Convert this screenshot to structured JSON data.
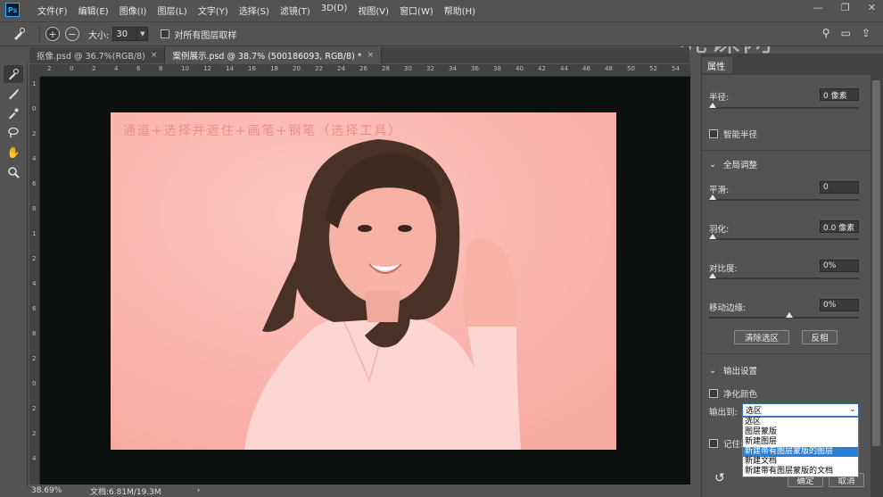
{
  "menubar": {
    "logo": "Ps",
    "items": [
      "文件(F)",
      "编辑(E)",
      "图像(I)",
      "图层(L)",
      "文字(Y)",
      "选择(S)",
      "滤镜(T)",
      "3D(D)",
      "视图(V)",
      "窗口(W)",
      "帮助(H)"
    ]
  },
  "watermark": "虎课网",
  "options": {
    "size_label": "大小:",
    "size_value": "30",
    "sample_all_layers": "对所有图层取样"
  },
  "tabs": [
    {
      "label": "抠像.psd @ 36.7%(RGB/8)",
      "close": "×"
    },
    {
      "label": "案例展示.psd @ 38.7% (500186093, RGB/8) *",
      "close": "×"
    }
  ],
  "ruler": {
    "h_ticks": [
      "2",
      "0",
      "2",
      "4",
      "6",
      "8",
      "10",
      "12",
      "14",
      "16",
      "18",
      "20",
      "22",
      "24",
      "26",
      "28",
      "30",
      "32",
      "34",
      "36",
      "38",
      "40",
      "42",
      "44",
      "46",
      "48",
      "50",
      "52",
      "54"
    ],
    "v_ticks": [
      "1",
      "0",
      "2",
      "4",
      "6",
      "8",
      "1",
      "2",
      "4",
      "6",
      "8",
      "2",
      "0",
      "2",
      "2",
      "4"
    ]
  },
  "canvas": {
    "title_text": "通道+选择并遮住+画笔+钢笔（选择工具）",
    "photo_bg": "#fbb5ad"
  },
  "status": {
    "zoom": "38.69%",
    "doc": "文档:6.81M/19.3M",
    "arrow": "›"
  },
  "panel": {
    "tab": "属性",
    "radius_label": "半径:",
    "radius_value": "0 像素",
    "smart_radius": "智能半径",
    "global_refine": "全局调整",
    "smooth_label": "平滑:",
    "smooth_value": "0",
    "feather_label": "羽化:",
    "feather_value": "0.0 像素",
    "contrast_label": "对比度:",
    "contrast_value": "0%",
    "shift_edge_label": "移动边缘:",
    "shift_edge_value": "0%",
    "clear_selection": "清除选区",
    "invert": "反相",
    "output_settings": "输出设置",
    "decontaminate": "净化颜色",
    "output_to_label": "输出到:",
    "output_to_value": "选区",
    "dropdown_options": [
      "选区",
      "图层蒙版",
      "新建图层",
      "新建带有图层蒙版的图层",
      "新建文档",
      "新建带有图层蒙版的文档"
    ],
    "highlighted_index": 3,
    "remember_settings": "记住设置",
    "ok": "确定",
    "cancel": "取消"
  }
}
